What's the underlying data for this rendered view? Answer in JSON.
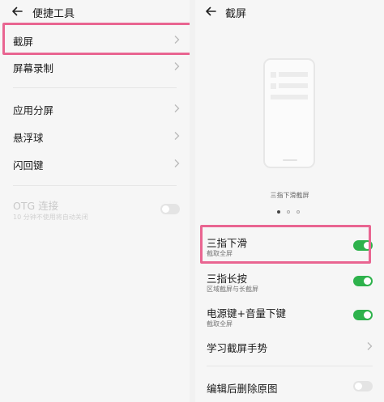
{
  "left": {
    "title": "便捷工具",
    "items": [
      {
        "label": "截屏"
      },
      {
        "label": "屏幕录制"
      },
      {
        "label": "应用分屏"
      },
      {
        "label": "悬浮球"
      },
      {
        "label": "闪回键"
      }
    ],
    "otg": {
      "label": "OTG 连接",
      "sublabel": "10 分钟不使用将自动关闭",
      "enabled": false
    }
  },
  "right": {
    "title": "截屏",
    "caption": "三指下滑截屏",
    "pager": {
      "count": 3,
      "active": 1
    },
    "options": [
      {
        "label": "三指下滑",
        "sub": "截取全屏",
        "toggle": true
      },
      {
        "label": "三指长按",
        "sub": "区域截屏与长截屏",
        "toggle": true
      },
      {
        "label": "电源键+音量下键",
        "sub": "截取全屏",
        "toggle": true
      },
      {
        "label": "学习截屏手势"
      },
      {
        "label": "编辑后删除原图",
        "toggle": false
      }
    ]
  },
  "colors": {
    "accent_green": "#2eb24c",
    "highlight": "#e96591"
  }
}
